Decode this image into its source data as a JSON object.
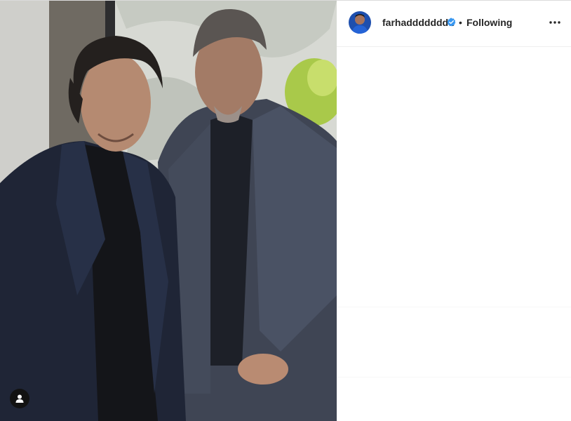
{
  "post": {
    "author": {
      "username": "farhadddddddd",
      "verified": true,
      "follow_status": "Following",
      "separator": "•"
    },
    "media": {
      "tag_icon": "user-tag-icon"
    },
    "icons": {
      "verified": "verified-badge-icon",
      "more": "more-options-icon"
    },
    "colors": {
      "verified_blue": "#3897f0",
      "text": "#262626",
      "border": "#dbdbdb"
    }
  }
}
